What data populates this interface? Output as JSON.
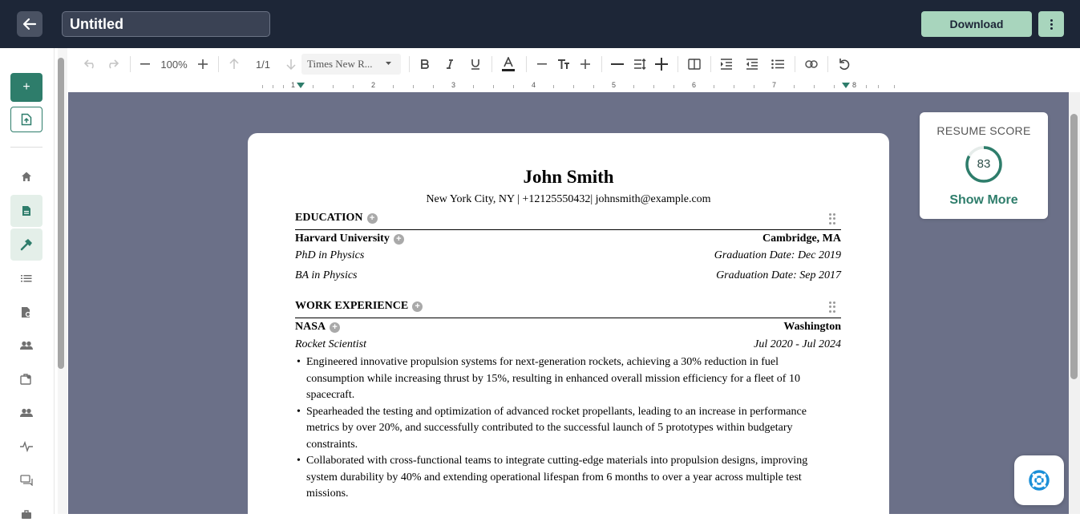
{
  "header": {
    "document_title": "Untitled",
    "download_label": "Download",
    "back_icon": "arrow-left-icon",
    "more_icon": "kebab-icon"
  },
  "sidebar": {
    "add_label": "+",
    "items": [
      {
        "icon": "home-icon"
      },
      {
        "icon": "document-icon"
      },
      {
        "icon": "hammer-icon"
      },
      {
        "icon": "list-icon"
      },
      {
        "icon": "doc-search-icon"
      },
      {
        "icon": "users-icon"
      },
      {
        "icon": "briefcase-search-icon"
      },
      {
        "icon": "group-icon"
      },
      {
        "icon": "activity-icon"
      },
      {
        "icon": "chat-icon"
      },
      {
        "icon": "briefcase-icon"
      }
    ]
  },
  "toolbar": {
    "zoom": "100%",
    "page": "1/1",
    "font": "Times New R..."
  },
  "ruler": {
    "numbers": [
      "1",
      "2",
      "3",
      "4",
      "5",
      "6",
      "7",
      "8"
    ]
  },
  "resume": {
    "name": "John Smith",
    "contact": "New York City, NY | +12125550432| johnsmith@example.com",
    "education": {
      "heading": "EDUCATION",
      "school": "Harvard University",
      "location": "Cambridge, MA",
      "degrees": [
        {
          "degree": "PhD in Physics",
          "date": "Graduation Date: Dec 2019"
        },
        {
          "degree": "BA in Physics",
          "date": "Graduation Date: Sep 2017"
        }
      ]
    },
    "work": {
      "heading": "WORK EXPERIENCE",
      "company": "NASA",
      "location": "Washington",
      "role": "Rocket Scientist",
      "dates": "Jul 2020 - Jul 2024",
      "bullets": [
        "Engineered innovative propulsion systems for next-generation rockets, achieving a 30% reduction in fuel consumption while increasing thrust by 15%, resulting in enhanced overall mission efficiency for a fleet of 10 spacecraft.",
        "Spearheaded the testing and optimization of advanced rocket propellants, leading to an increase in performance metrics by over 20%, and successfully contributed to the successful launch of 5 prototypes within budgetary constraints.",
        "Collaborated with cross-functional teams to integrate cutting-edge materials into propulsion designs, improving system durability by 40% and extending operational lifespan from 6 months to over a year across multiple test missions."
      ]
    }
  },
  "score": {
    "label": "RESUME SCORE",
    "value": "83",
    "percent": 83,
    "show_more": "Show More",
    "ring_color": "#2e7d6b"
  },
  "colors": {
    "accent": "#2e7d6b",
    "topbar": "#1d2637",
    "canvas": "#6b7088"
  }
}
